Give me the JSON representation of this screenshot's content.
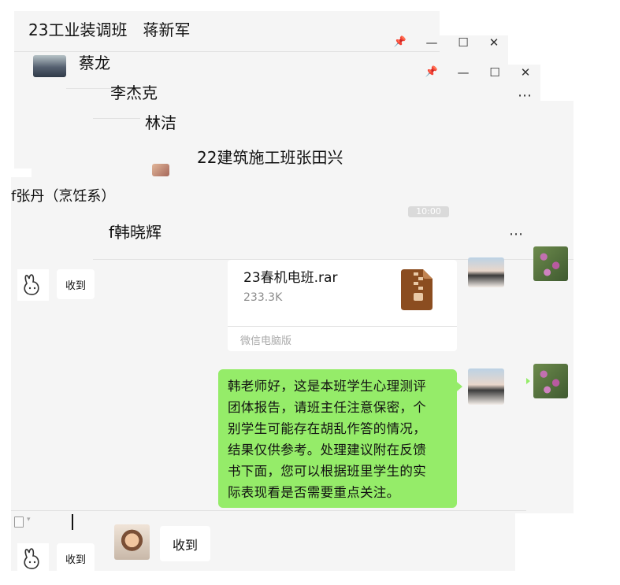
{
  "windows": [
    {
      "title": "23工业装调班　蒋新军",
      "controls": [
        "📌",
        "—",
        "☐",
        "✕"
      ]
    },
    {
      "title": "蔡龙",
      "controls": [
        "📌",
        "—",
        "☐",
        "✕"
      ]
    },
    {
      "title": "李杰克",
      "controls": [
        "⋯"
      ]
    },
    {
      "title": "林洁"
    },
    {
      "title": "22建筑施工班张田兴"
    },
    {
      "title": "张丹（烹饪系）"
    },
    {
      "title": "韩晓辉",
      "more": "⋯"
    }
  ],
  "title_fragments": {
    "zhang_prefix": "f",
    "han_prefix": "f"
  },
  "messages": {
    "reply_small_1": "收到",
    "file": {
      "name": "23春机电班.rar",
      "size": "233.3K",
      "source": "微信电脑版"
    },
    "report": "韩老师好，这是本班学生心理测评\n团体报告，请班主任注意保密，个\n别学生可能存在胡乱作答的情况，\n结果仅供参考。处理建议附在反馈\n书下面，您可以根据班里学生的实\n际表现看是否需要重点关注。",
    "reply_large": "收到",
    "reply_small_2": "收到",
    "time_partial": "10:00"
  },
  "input": {
    "file_icon": "file-icon",
    "dropdown": "▾"
  },
  "colors": {
    "green_bubble": "#95ec69",
    "window_bg": "#f5f5f5",
    "rar_brown": "#8b4d20"
  }
}
